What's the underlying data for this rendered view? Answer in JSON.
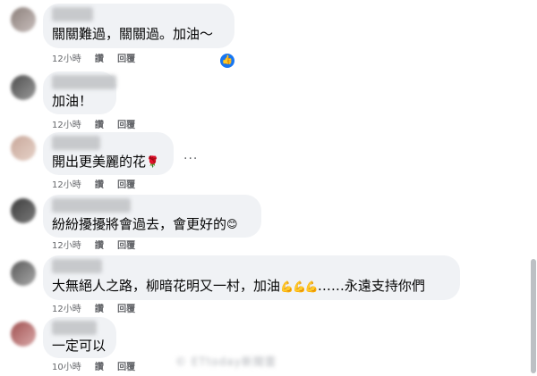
{
  "comments": [
    {
      "text": "關關難過，關關過。加油～",
      "time": "12小時",
      "like": "讚",
      "reply": "回覆",
      "avatar_colors": [
        "#8b7f7a",
        "#c9bfbd"
      ]
    },
    {
      "text": "加油！",
      "time": "12小時",
      "like": "讚",
      "reply": "回覆",
      "avatar_colors": [
        "#4e4e4e",
        "#9a9a9a"
      ]
    },
    {
      "text": "開出更美麗的花",
      "emoji": "🌹",
      "time": "12小時",
      "like": "讚",
      "reply": "回覆",
      "avatar_colors": [
        "#c8a79a",
        "#e6d2c8"
      ]
    },
    {
      "text": "紛紛擾擾將會過去，會更好的",
      "emoji": "😊",
      "time": "12小時",
      "like": "讚",
      "reply": "回覆",
      "avatar_colors": [
        "#3d3d3d",
        "#7b7b7b"
      ]
    },
    {
      "text_before": "大無絕人之路，柳暗花明又一村，加油",
      "emoji": "💪💪💪",
      "text_after": "……永遠支持你們",
      "time": "12小時",
      "like": "讚",
      "reply": "回覆",
      "avatar_colors": [
        "#5a5a5a",
        "#a8a8a8"
      ]
    },
    {
      "text": "一定可以",
      "time": "10小時",
      "like": "讚",
      "reply": "回覆",
      "avatar_colors": [
        "#a05050",
        "#d9a9a9"
      ]
    }
  ],
  "more_icon": "ellipsis-icon",
  "reaction_icon": "thumbs-up-icon",
  "reaction_glyph": "👍",
  "more_glyph": "···",
  "watermark": "© ETtoday新聞雲",
  "colors": {
    "bubble": "#f0f2f5",
    "meta": "#65676b",
    "accent": "#1877f2"
  }
}
